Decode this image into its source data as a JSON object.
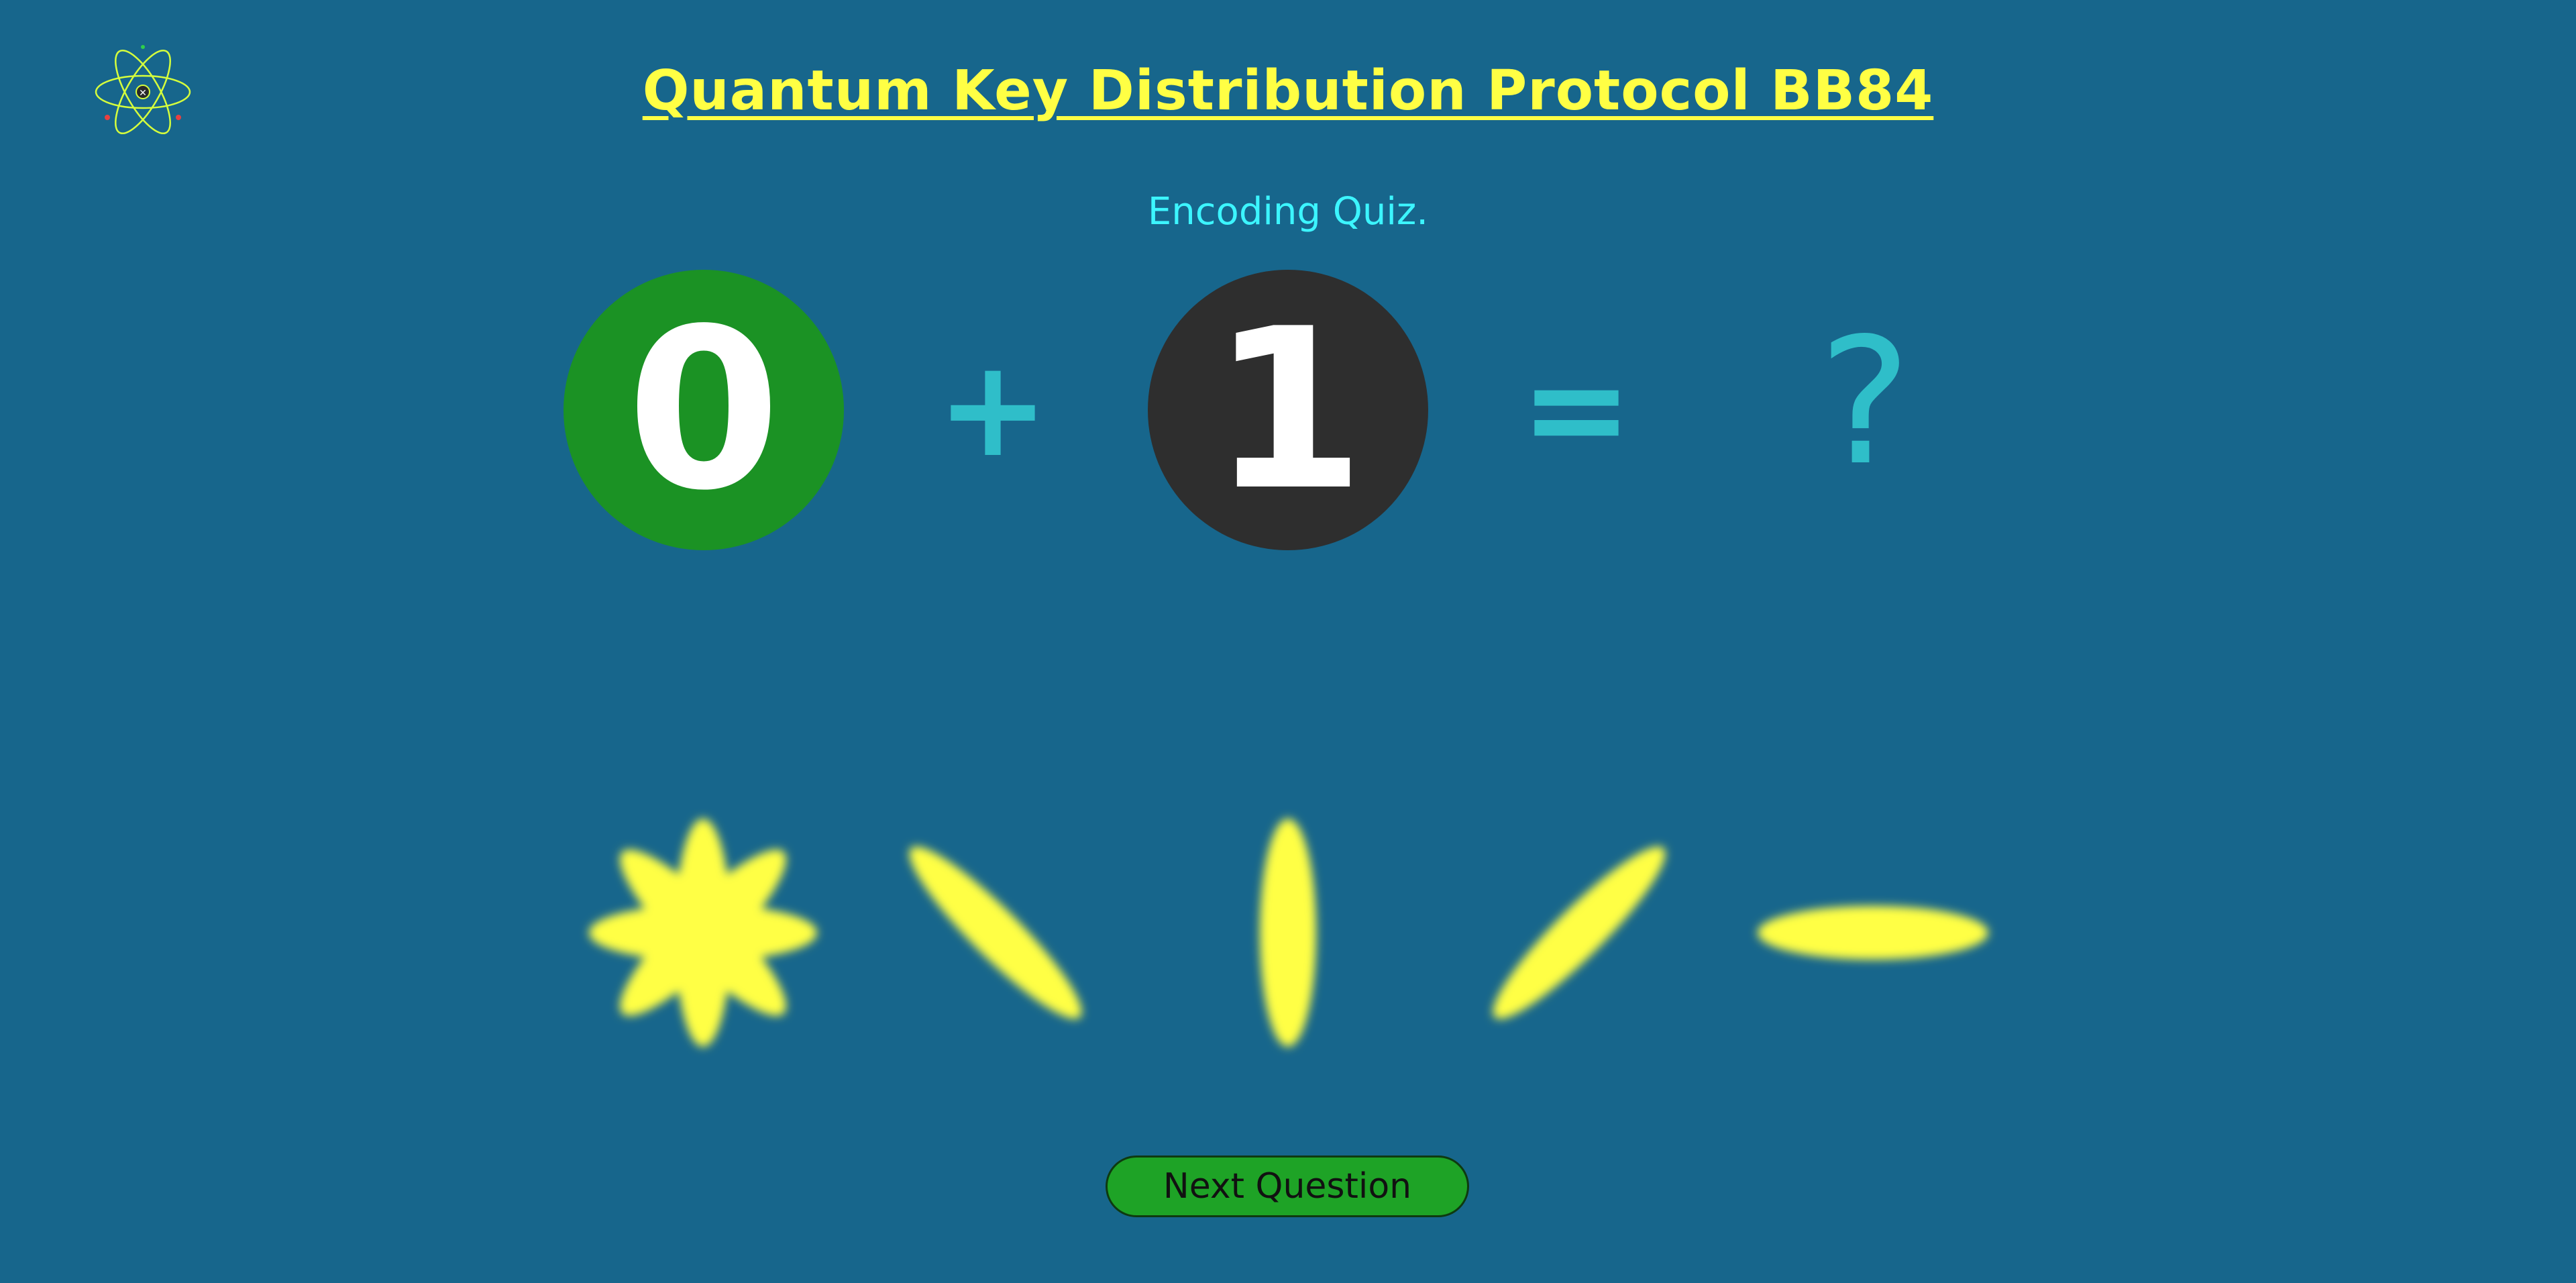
{
  "header": {
    "title": "Quantum Key Distribution Protocol BB84",
    "subtitle": "Encoding Quiz."
  },
  "logo": {
    "icon": "atom-icon",
    "colors": [
      "#ffff44",
      "#2fd04a",
      "#e84040"
    ]
  },
  "equation": {
    "bit_a": "0",
    "bit_a_color": "#1b9224",
    "operator_plus": "+",
    "bit_b": "1",
    "bit_b_color": "#2e2e2e",
    "operator_equals": "=",
    "result": "?"
  },
  "choices": [
    {
      "name": "star-polarization",
      "icon": "eight-point-star-icon"
    },
    {
      "name": "diagonal-left",
      "icon": "backslash-ellipse-icon",
      "angle_deg": 135
    },
    {
      "name": "vertical",
      "icon": "vertical-ellipse-icon",
      "angle_deg": 90
    },
    {
      "name": "diagonal-right",
      "icon": "slash-ellipse-icon",
      "angle_deg": 45
    },
    {
      "name": "horizontal",
      "icon": "horizontal-ellipse-icon",
      "angle_deg": 0
    }
  ],
  "colors": {
    "background": "#17668c",
    "title": "#ffff44",
    "subtitle": "#3cf5ff",
    "operator": "#2fbec9",
    "choice_glow": "#ffff44",
    "button": "#1ea326"
  },
  "footer": {
    "next_label": "Next Question"
  }
}
